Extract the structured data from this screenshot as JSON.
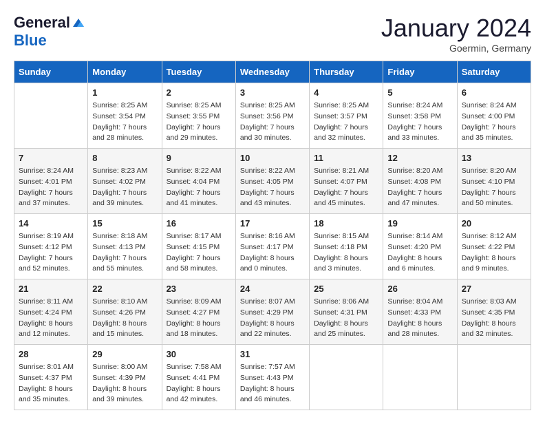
{
  "logo": {
    "general": "General",
    "blue": "Blue"
  },
  "title": "January 2024",
  "subtitle": "Goermin, Germany",
  "header_days": [
    "Sunday",
    "Monday",
    "Tuesday",
    "Wednesday",
    "Thursday",
    "Friday",
    "Saturday"
  ],
  "weeks": [
    [
      {
        "day": "",
        "info": ""
      },
      {
        "day": "1",
        "info": "Sunrise: 8:25 AM\nSunset: 3:54 PM\nDaylight: 7 hours\nand 28 minutes."
      },
      {
        "day": "2",
        "info": "Sunrise: 8:25 AM\nSunset: 3:55 PM\nDaylight: 7 hours\nand 29 minutes."
      },
      {
        "day": "3",
        "info": "Sunrise: 8:25 AM\nSunset: 3:56 PM\nDaylight: 7 hours\nand 30 minutes."
      },
      {
        "day": "4",
        "info": "Sunrise: 8:25 AM\nSunset: 3:57 PM\nDaylight: 7 hours\nand 32 minutes."
      },
      {
        "day": "5",
        "info": "Sunrise: 8:24 AM\nSunset: 3:58 PM\nDaylight: 7 hours\nand 33 minutes."
      },
      {
        "day": "6",
        "info": "Sunrise: 8:24 AM\nSunset: 4:00 PM\nDaylight: 7 hours\nand 35 minutes."
      }
    ],
    [
      {
        "day": "7",
        "info": "Sunrise: 8:24 AM\nSunset: 4:01 PM\nDaylight: 7 hours\nand 37 minutes."
      },
      {
        "day": "8",
        "info": "Sunrise: 8:23 AM\nSunset: 4:02 PM\nDaylight: 7 hours\nand 39 minutes."
      },
      {
        "day": "9",
        "info": "Sunrise: 8:22 AM\nSunset: 4:04 PM\nDaylight: 7 hours\nand 41 minutes."
      },
      {
        "day": "10",
        "info": "Sunrise: 8:22 AM\nSunset: 4:05 PM\nDaylight: 7 hours\nand 43 minutes."
      },
      {
        "day": "11",
        "info": "Sunrise: 8:21 AM\nSunset: 4:07 PM\nDaylight: 7 hours\nand 45 minutes."
      },
      {
        "day": "12",
        "info": "Sunrise: 8:20 AM\nSunset: 4:08 PM\nDaylight: 7 hours\nand 47 minutes."
      },
      {
        "day": "13",
        "info": "Sunrise: 8:20 AM\nSunset: 4:10 PM\nDaylight: 7 hours\nand 50 minutes."
      }
    ],
    [
      {
        "day": "14",
        "info": "Sunrise: 8:19 AM\nSunset: 4:12 PM\nDaylight: 7 hours\nand 52 minutes."
      },
      {
        "day": "15",
        "info": "Sunrise: 8:18 AM\nSunset: 4:13 PM\nDaylight: 7 hours\nand 55 minutes."
      },
      {
        "day": "16",
        "info": "Sunrise: 8:17 AM\nSunset: 4:15 PM\nDaylight: 7 hours\nand 58 minutes."
      },
      {
        "day": "17",
        "info": "Sunrise: 8:16 AM\nSunset: 4:17 PM\nDaylight: 8 hours\nand 0 minutes."
      },
      {
        "day": "18",
        "info": "Sunrise: 8:15 AM\nSunset: 4:18 PM\nDaylight: 8 hours\nand 3 minutes."
      },
      {
        "day": "19",
        "info": "Sunrise: 8:14 AM\nSunset: 4:20 PM\nDaylight: 8 hours\nand 6 minutes."
      },
      {
        "day": "20",
        "info": "Sunrise: 8:12 AM\nSunset: 4:22 PM\nDaylight: 8 hours\nand 9 minutes."
      }
    ],
    [
      {
        "day": "21",
        "info": "Sunrise: 8:11 AM\nSunset: 4:24 PM\nDaylight: 8 hours\nand 12 minutes."
      },
      {
        "day": "22",
        "info": "Sunrise: 8:10 AM\nSunset: 4:26 PM\nDaylight: 8 hours\nand 15 minutes."
      },
      {
        "day": "23",
        "info": "Sunrise: 8:09 AM\nSunset: 4:27 PM\nDaylight: 8 hours\nand 18 minutes."
      },
      {
        "day": "24",
        "info": "Sunrise: 8:07 AM\nSunset: 4:29 PM\nDaylight: 8 hours\nand 22 minutes."
      },
      {
        "day": "25",
        "info": "Sunrise: 8:06 AM\nSunset: 4:31 PM\nDaylight: 8 hours\nand 25 minutes."
      },
      {
        "day": "26",
        "info": "Sunrise: 8:04 AM\nSunset: 4:33 PM\nDaylight: 8 hours\nand 28 minutes."
      },
      {
        "day": "27",
        "info": "Sunrise: 8:03 AM\nSunset: 4:35 PM\nDaylight: 8 hours\nand 32 minutes."
      }
    ],
    [
      {
        "day": "28",
        "info": "Sunrise: 8:01 AM\nSunset: 4:37 PM\nDaylight: 8 hours\nand 35 minutes."
      },
      {
        "day": "29",
        "info": "Sunrise: 8:00 AM\nSunset: 4:39 PM\nDaylight: 8 hours\nand 39 minutes."
      },
      {
        "day": "30",
        "info": "Sunrise: 7:58 AM\nSunset: 4:41 PM\nDaylight: 8 hours\nand 42 minutes."
      },
      {
        "day": "31",
        "info": "Sunrise: 7:57 AM\nSunset: 4:43 PM\nDaylight: 8 hours\nand 46 minutes."
      },
      {
        "day": "",
        "info": ""
      },
      {
        "day": "",
        "info": ""
      },
      {
        "day": "",
        "info": ""
      }
    ]
  ]
}
